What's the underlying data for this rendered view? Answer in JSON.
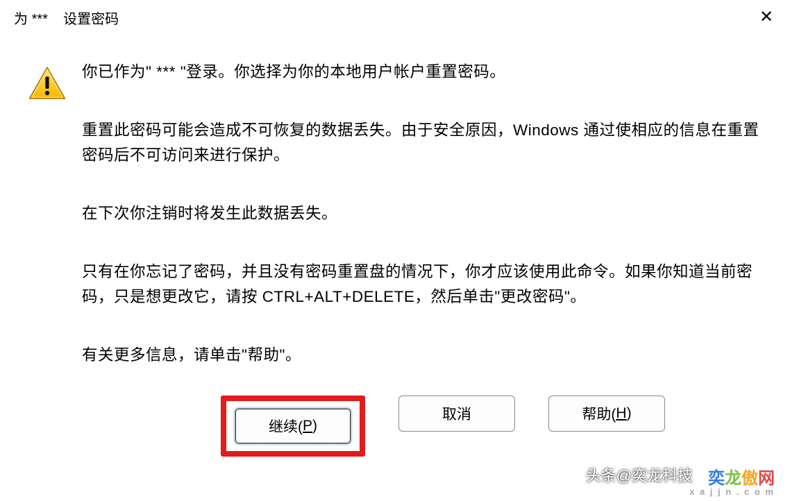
{
  "title": {
    "prefix": "为 ",
    "username": "***",
    "suffix": " 设置密码"
  },
  "close_symbol": "✕",
  "paragraphs": {
    "p1_before": "你已作为\"",
    "p1_user": " *** ",
    "p1_after": "\"登录。你选择为你的本地用户帐户重置密码。",
    "p2": "重置此密码可能会造成不可恢复的数据丢失。由于安全原因，Windows 通过使相应的信息在重置密码后不可访问来进行保护。",
    "p3": "在下次你注销时将发生此数据丢失。",
    "p4": "只有在你忘记了密码，并且没有密码重置盘的情况下，你才应该使用此命令。如果你知道当前密码，只是想更改它，请按 CTRL+ALT+DELETE，然后单击\"更改密码\"。",
    "p5": "有关更多信息，请单击\"帮助\"。"
  },
  "buttons": {
    "continue": {
      "label_pre": "继续(",
      "accel": "P",
      "label_post": ")"
    },
    "cancel": {
      "label": "取消"
    },
    "help": {
      "label_pre": "帮助(",
      "accel": "H",
      "label_post": ")"
    }
  },
  "watermarks": {
    "w1": "头条@奕龙科技",
    "w2_main_chars": [
      "奕",
      "龙",
      "傲",
      "网"
    ],
    "w2_sub": "x a j j n . c o m"
  }
}
